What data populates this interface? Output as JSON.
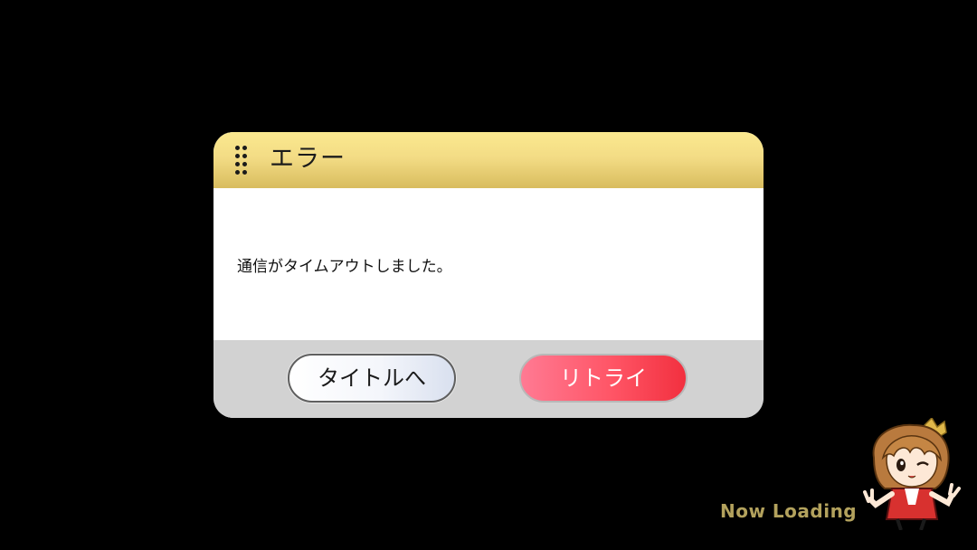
{
  "dialog": {
    "title": "エラー",
    "message": "通信がタイムアウトしました。",
    "buttons": {
      "title_label": "タイトルへ",
      "retry_label": "リトライ"
    }
  },
  "loading": {
    "text": "Now Loading"
  },
  "icons": {
    "header_grip": "grip-dots-icon",
    "mascot": "mascot-character-icon"
  },
  "colors": {
    "background": "#000000",
    "header_gold": "#f3dc85",
    "body_white": "#ffffff",
    "footer_gray": "#d2d2d2",
    "retry_red": "#ff5566",
    "loading_gold": "#b3a25d"
  }
}
